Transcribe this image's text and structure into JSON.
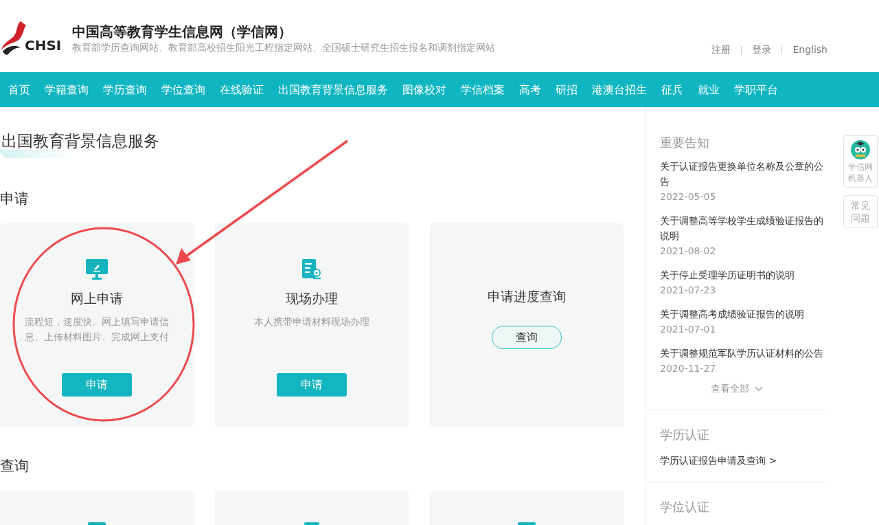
{
  "header": {
    "logo_text": "CHSI",
    "title": "中国高等教育学生信息网（学信网）",
    "subtitle": "教育部学历查询网站、教育部高校招生阳光工程指定网站、全国硕士研究生招生报名和调剂指定网站",
    "links": [
      "注册",
      "登录",
      "English"
    ]
  },
  "nav": [
    {
      "label": "首页"
    },
    {
      "label": "学籍查询"
    },
    {
      "label": "学历查询"
    },
    {
      "label": "学位查询"
    },
    {
      "label": "在线验证"
    },
    {
      "label": "出国教育背景信息服务"
    },
    {
      "label": "图像校对"
    },
    {
      "label": "学信档案"
    },
    {
      "label": "高考"
    },
    {
      "label": "研招"
    },
    {
      "label": "港澳台招生"
    },
    {
      "label": "征兵"
    },
    {
      "label": "就业"
    },
    {
      "label": "学职平台"
    }
  ],
  "page_title": "出国教育背景信息服务",
  "apply_section": {
    "heading": "申请",
    "cards": [
      {
        "kind": "monitor",
        "title": "网上申请",
        "description": "流程短，速度快。网上填写申请信息、上传材料图片、完成网上支付",
        "button": {
          "label": "申请",
          "kind": "filled"
        }
      },
      {
        "kind": "document",
        "title": "现场办理",
        "description": "本人携带申请材料现场办理",
        "button": {
          "label": "申请",
          "kind": "filled"
        }
      },
      {
        "kind": "none",
        "title": "申请进度查询",
        "button": {
          "label": "查询",
          "kind": "outline"
        }
      }
    ]
  },
  "query_section": {
    "heading": "查询",
    "cards": [
      {
        "kind": "monitor"
      },
      {
        "kind": "document"
      },
      {
        "kind": "monitor"
      }
    ]
  },
  "sidebar": {
    "notices_heading": "重要告知",
    "notices": [
      {
        "title": "关于认证报告更换单位名称及公章的公告",
        "date": "2022-05-05"
      },
      {
        "title": "关于调整高等学校学生成绩验证报告的说明",
        "date": "2021-08-02"
      },
      {
        "title": "关于停止受理学历证明书的说明",
        "date": "2021-07-23"
      },
      {
        "title": "关于调整高考成绩验证报告的说明",
        "date": "2021-07-01"
      },
      {
        "title": "关于调整规范军队学历认证材料的公告",
        "date": "2020-11-27"
      }
    ],
    "view_all": "查看全部",
    "sections": [
      {
        "heading": "学历认证",
        "link": "学历认证报告申请及查询 >"
      },
      {
        "heading": "学位认证"
      }
    ]
  },
  "float_widgets": [
    {
      "kind": "robot",
      "label": "学信网机器人"
    },
    {
      "kind": "text",
      "label": "常见问题"
    }
  ],
  "annotation": {
    "kind": "circle-arrow"
  }
}
